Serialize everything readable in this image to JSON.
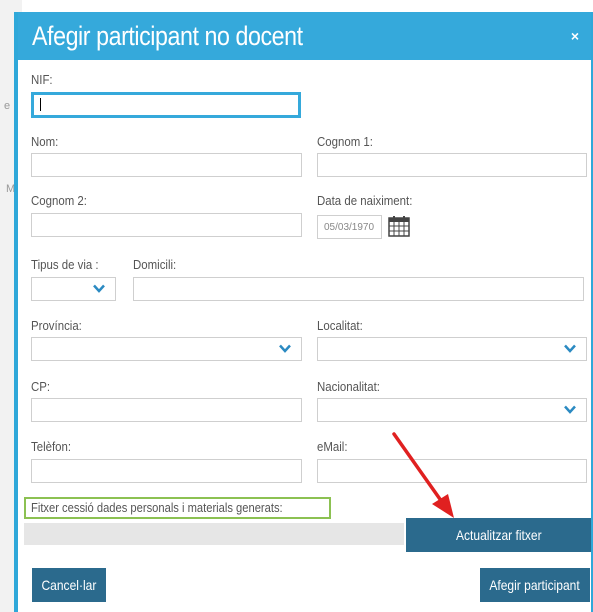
{
  "modal": {
    "title": "Afegir participant no docent",
    "close_label": "×"
  },
  "form": {
    "nif_label": "NIF:",
    "nom_label": "Nom:",
    "cognom1_label": "Cognom 1:",
    "cognom2_label": "Cognom 2:",
    "data_naixement_label": "Data de naiximent:",
    "data_naixement_value": "05/03/1970",
    "tipus_via_label": "Tipus de via :",
    "domicili_label": "Domicili:",
    "provincia_label": "Província:",
    "localitat_label": "Localitat:",
    "cp_label": "CP:",
    "nacionalitat_label": "Nacionalitat:",
    "telefon_label": "Telèfon:",
    "email_label": "eMail:"
  },
  "file": {
    "label": "Fitxer cessió dades personals i materials generats:",
    "update_button": "Actualitzar fitxer"
  },
  "footer": {
    "cancel_button": "Cancel·lar",
    "add_button": "Afegir participant"
  },
  "colors": {
    "header": "#35a9db",
    "button": "#2b6a8d",
    "highlight_border": "#8cc152",
    "annotation_arrow": "#e02020"
  }
}
